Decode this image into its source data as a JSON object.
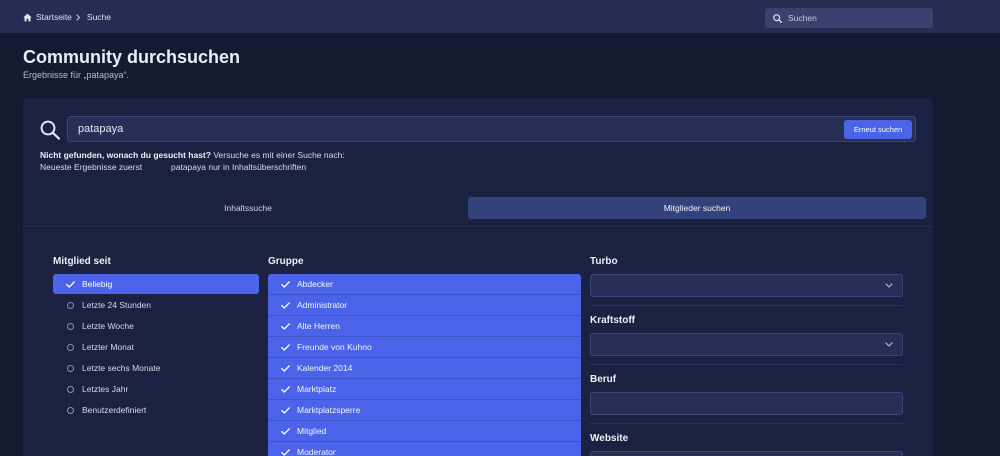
{
  "colors": {
    "page_background": "#141a31",
    "header_background": "#252d52",
    "panel_background": "#1b2141",
    "accent": "#4a63e8",
    "tab_active": "#35417a",
    "input_background": "#272f57"
  },
  "header": {
    "breadcrumb": [
      {
        "label": "Startseite",
        "icon": "home-icon"
      },
      {
        "label": "Suche"
      }
    ],
    "separator_icon": "chevron-right-icon",
    "search": {
      "placeholder": "Suchen",
      "icon": "search-icon"
    }
  },
  "page": {
    "title": "Community durchsuchen",
    "subtitle": "Ergebnisse für „patapaya“."
  },
  "search_form": {
    "icon": "search-icon",
    "query": "patapaya",
    "submit_label": "Erneut suchen",
    "hint_bold": "Nicht gefunden, wonach du gesucht hast?",
    "hint_text": "Versuche es mit einer Suche nach:",
    "suggestions": [
      "Neueste Ergebnisse zuerst",
      "patapaya nur in Inhaltsüberschriften"
    ]
  },
  "tabs": [
    {
      "label": "Inhaltssuche",
      "active": false
    },
    {
      "label": "Mitglieder suchen",
      "active": true
    }
  ],
  "filters": {
    "member_since": {
      "heading": "Mitglied seit",
      "options": [
        {
          "label": "Beliebig",
          "selected": true
        },
        {
          "label": "Letzte 24 Stunden",
          "selected": false
        },
        {
          "label": "Letzte Woche",
          "selected": false
        },
        {
          "label": "Letzter Monat",
          "selected": false
        },
        {
          "label": "Letzte sechs Monate",
          "selected": false
        },
        {
          "label": "Letztes Jahr",
          "selected": false
        },
        {
          "label": "Benutzerdefiniert",
          "selected": false
        }
      ]
    },
    "group": {
      "heading": "Gruppe",
      "option_icon": "check-icon",
      "options": [
        {
          "label": "Abdecker",
          "checked": true
        },
        {
          "label": "Administrator",
          "checked": true
        },
        {
          "label": "Alte Herren",
          "checked": true
        },
        {
          "label": "Freunde von Kuhno",
          "checked": true
        },
        {
          "label": "Kalender 2014",
          "checked": true
        },
        {
          "label": "Marktplatz",
          "checked": true
        },
        {
          "label": "Marktplatzsperre",
          "checked": true
        },
        {
          "label": "Mitglied",
          "checked": true
        },
        {
          "label": "Moderator",
          "checked": true
        }
      ]
    },
    "profile_fields": [
      {
        "label": "Turbo",
        "dropdown": true
      },
      {
        "label": "Kraftstoff",
        "dropdown": true
      },
      {
        "label": "Beruf",
        "dropdown": false
      },
      {
        "label": "Website",
        "dropdown": false
      }
    ]
  }
}
